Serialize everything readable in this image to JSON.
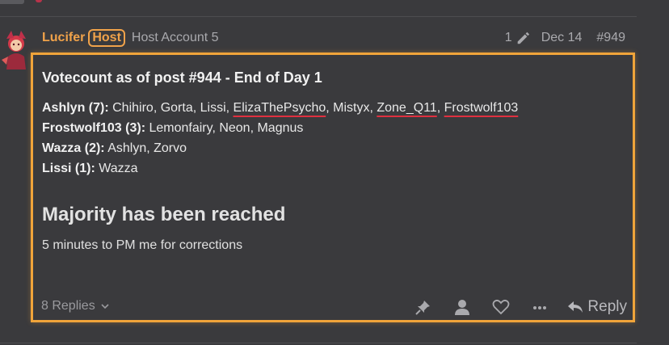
{
  "post": {
    "username": "Lucifer",
    "badge": "Host",
    "user_title": "Host Account 5",
    "edit_count": "1",
    "date": "Dec 14",
    "post_number": "#949"
  },
  "content": {
    "heading": "Votecount as of post #944 - End of Day 1",
    "votes": [
      {
        "target": "Ashlyn (7):",
        "voters": [
          {
            "name": "Chihiro",
            "underlined": false
          },
          {
            "name": "Gorta",
            "underlined": false
          },
          {
            "name": "Lissi",
            "underlined": false
          },
          {
            "name": "ElizaThePsycho",
            "underlined": true
          },
          {
            "name": "Mistyx",
            "underlined": false
          },
          {
            "name": "Zone_Q11",
            "underlined": true
          },
          {
            "name": "Frostwolf103",
            "underlined": true
          }
        ]
      },
      {
        "target": "Frostwolf103 (3):",
        "voters": [
          {
            "name": "Lemonfairy",
            "underlined": false
          },
          {
            "name": "Neon",
            "underlined": false
          },
          {
            "name": "Magnus",
            "underlined": false
          }
        ]
      },
      {
        "target": "Wazza (2):",
        "voters": [
          {
            "name": "Ashlyn",
            "underlined": false
          },
          {
            "name": "Zorvo",
            "underlined": false
          }
        ]
      },
      {
        "target": "Lissi (1):",
        "voters": [
          {
            "name": "Wazza",
            "underlined": false
          }
        ]
      }
    ],
    "majority": "Majority has been reached",
    "corrections": "5 minutes to PM me for corrections"
  },
  "footer": {
    "replies": "8 Replies",
    "reply_label": "Reply"
  },
  "icons": {
    "edit": "pencil-icon",
    "replies_toggle": "chevron-down-icon",
    "pin": "pin-icon",
    "user": "user-icon",
    "like": "heart-icon",
    "more": "ellipsis-icon",
    "reply": "reply-arrow-icon"
  },
  "colors": {
    "accent": "#f0a24a",
    "highlight_border": "#f0a43a",
    "underline": "#e03040",
    "background": "#3a3a3d"
  }
}
